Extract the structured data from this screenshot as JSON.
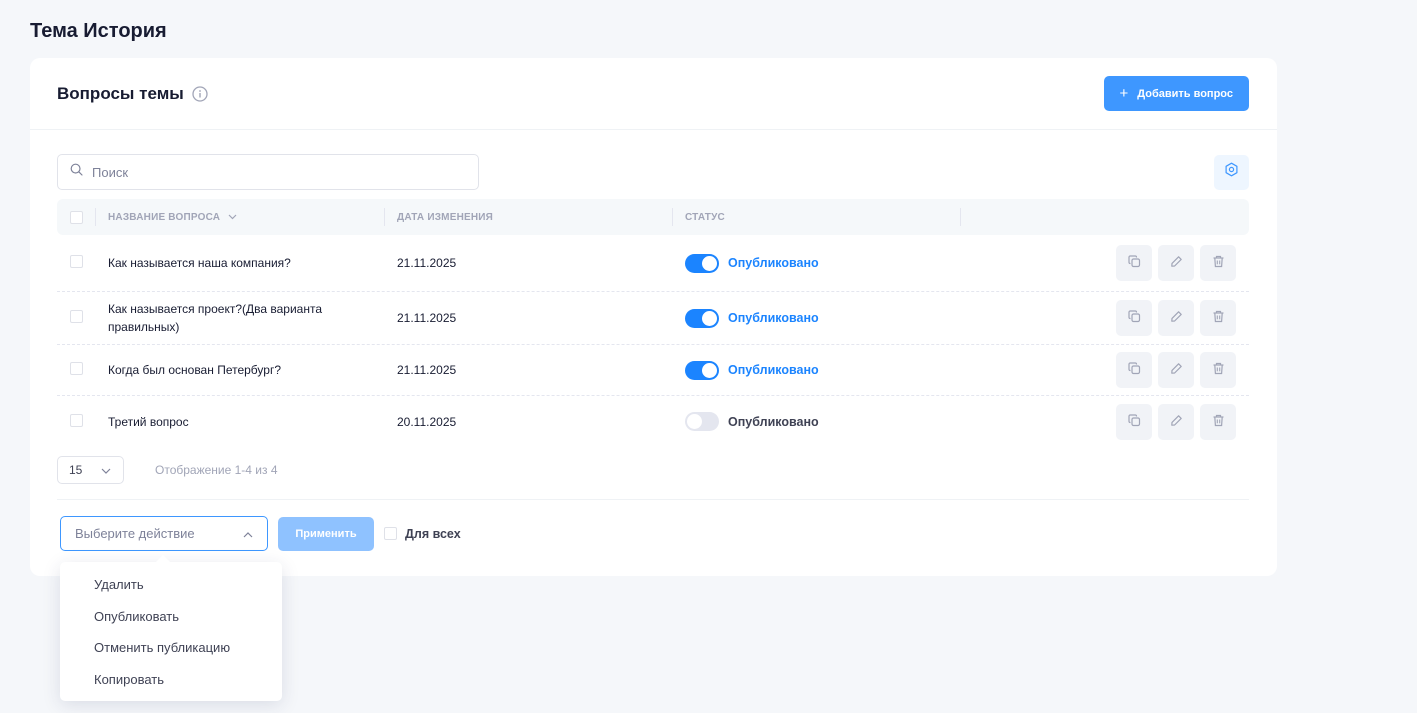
{
  "page": {
    "title": "Тема История"
  },
  "card": {
    "title": "Вопросы темы",
    "add_button_label": "Добавить вопрос",
    "add_button_icon": "+"
  },
  "search": {
    "placeholder": "Поиск",
    "value": ""
  },
  "table": {
    "columns": {
      "name": "НАЗВАНИЕ ВОПРОСА",
      "date": "ДАТА ИЗМЕНЕНИЯ",
      "status": "СТАТУС"
    },
    "rows": [
      {
        "name": "Как называется наша компания?",
        "date": "21.11.2025",
        "status": "Опубликовано",
        "published": true
      },
      {
        "name": "Как называется проект?(Два варианта правильных)",
        "date": "21.11.2025",
        "status": "Опубликовано",
        "published": true
      },
      {
        "name": "Когда был основан Петербург?",
        "date": "21.11.2025",
        "status": "Опубликовано",
        "published": true
      },
      {
        "name": "Третий вопрос",
        "date": "20.11.2025",
        "status": "Опубликовано",
        "published": false
      }
    ]
  },
  "pagination": {
    "per_page": "15",
    "summary": "Отображение 1-4 из 4"
  },
  "bulk": {
    "select_placeholder": "Выберите действие",
    "apply_label": "Применить",
    "for_all_label": "Для всех",
    "options": [
      "Удалить",
      "Опубликовать",
      "Отменить публикацию",
      "Копировать"
    ]
  },
  "colors": {
    "primary": "#3e97ff",
    "switch_on": "#1b84ff",
    "switch_off": "#e4e6ef",
    "apply_disabled": "#8fc2ff"
  },
  "icons": {
    "info": "info-icon",
    "search": "search-icon",
    "settings": "settings-icon",
    "sort": "chevron-down-icon",
    "copy": "copy-icon",
    "edit": "pencil-icon",
    "delete": "trash-icon"
  }
}
